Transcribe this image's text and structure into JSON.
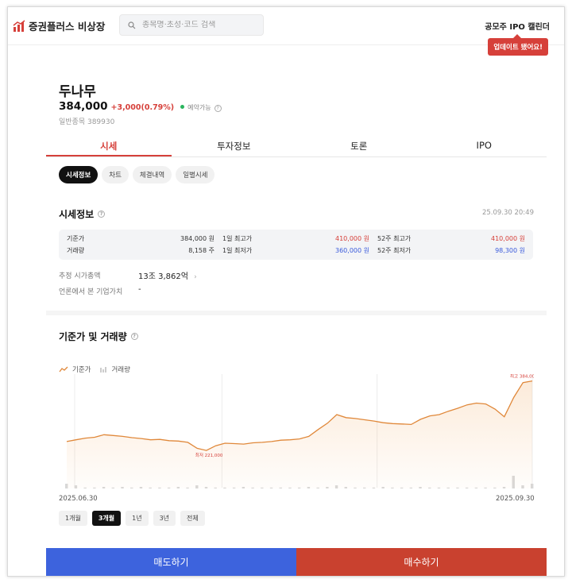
{
  "header": {
    "logo_text": "증권플러스 비상장",
    "search_placeholder": "종목명·초성·코드 검색",
    "ipo_link": "공모주 IPO 캘린더",
    "tooltip": "업데이트 됐어요!"
  },
  "stock": {
    "name": "두나무",
    "price": "384,000",
    "change": "+3,000(0.79%)",
    "reserve_label": "예약가능",
    "code": "일반종목 389930"
  },
  "tabs": [
    "시세",
    "투자정보",
    "토론",
    "IPO"
  ],
  "subtabs": [
    "시세정보",
    "차트",
    "체결내역",
    "일별시세"
  ],
  "price_info": {
    "title": "시세정보",
    "updated": "25.09.30 20:49",
    "rows": [
      [
        {
          "label": "기준가",
          "value": "384,000 원"
        },
        {
          "label": "1일 최고가",
          "value": "410,000 원"
        },
        {
          "label": "52주 최고가",
          "value": "410,000 원"
        }
      ],
      [
        {
          "label": "거래량",
          "value": "8,158 주"
        },
        {
          "label": "1일 최저가",
          "value": "360,000 원"
        },
        {
          "label": "52주 최저가",
          "value": "98,300 원"
        }
      ]
    ],
    "market_cap_label": "추정 시가총액",
    "market_cap_value": "13조 3,862억",
    "media_value_label": "언론에서 본 기업가치",
    "media_value": "-"
  },
  "chart_section": {
    "title": "기준가 및 거래량",
    "legend_price": "기준가",
    "legend_volume": "거래량",
    "start_date": "2025.06.30",
    "end_date": "2025.09.30",
    "periods": [
      "1개월",
      "3개월",
      "1년",
      "3년",
      "전체"
    ]
  },
  "chart_data": {
    "type": "line",
    "x_range": [
      "2025.06.30",
      "2025.09.30"
    ],
    "series": [
      {
        "name": "기준가",
        "values": [
          242000,
          246000,
          250000,
          252000,
          258000,
          256000,
          254000,
          251000,
          249000,
          246000,
          247000,
          244000,
          243000,
          240000,
          226000,
          221000,
          232000,
          238000,
          237000,
          236000,
          239000,
          240000,
          242000,
          245000,
          246000,
          248000,
          254000,
          270000,
          285000,
          305000,
          298000,
          296000,
          293000,
          290000,
          286000,
          284000,
          283000,
          282000,
          294000,
          302000,
          305000,
          313000,
          320000,
          328000,
          332000,
          330000,
          318000,
          300000,
          345000,
          380000,
          384000
        ]
      },
      {
        "name": "거래량",
        "values": [
          3,
          2,
          0,
          0,
          1,
          0,
          1,
          0,
          1,
          0,
          0,
          0,
          1,
          0,
          2,
          1,
          0,
          0,
          0,
          1,
          0,
          0,
          0,
          0,
          0,
          0,
          1,
          0,
          1,
          2,
          1,
          0,
          0,
          0,
          1,
          0,
          0,
          0,
          1,
          0,
          0,
          0,
          0,
          0,
          0,
          0,
          0,
          1,
          8,
          2,
          3
        ]
      }
    ],
    "annotations": [
      {
        "label": "최저 221,000",
        "value": 221000
      },
      {
        "label": "최고 384,000",
        "value": 384000
      }
    ],
    "grid": true,
    "line_color": "#e0883a"
  },
  "actions": {
    "sell": "매도하기",
    "buy": "매수하기"
  }
}
